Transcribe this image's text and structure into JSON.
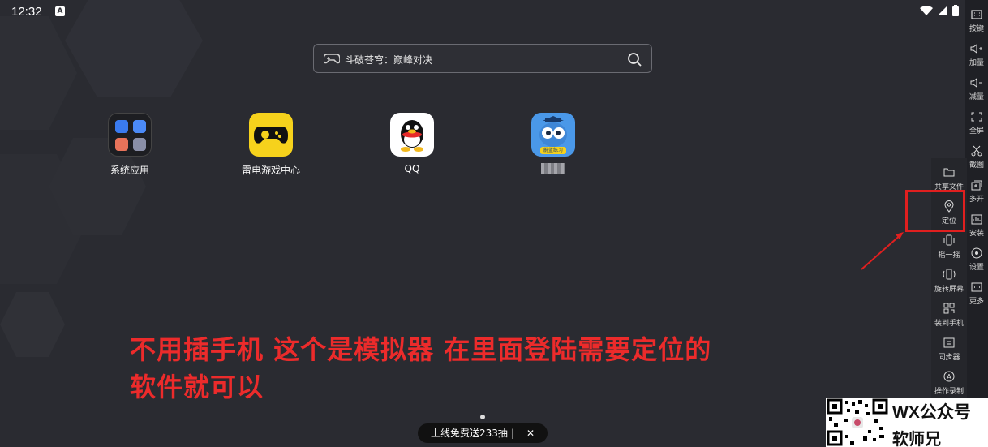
{
  "status_bar": {
    "time": "12:32"
  },
  "search": {
    "text": "斗破苍穹：巅峰对决"
  },
  "apps": [
    {
      "label": "系统应用"
    },
    {
      "label": "雷电游戏中心"
    },
    {
      "label": "QQ"
    },
    {
      "label": "",
      "icon_text": "蔚蓝练习"
    }
  ],
  "right_rail": [
    {
      "label": "按键"
    },
    {
      "label": "加量"
    },
    {
      "label": "减量"
    },
    {
      "label": "全屏"
    },
    {
      "label": "截图"
    },
    {
      "label": "多开"
    },
    {
      "label": "安装"
    },
    {
      "label": "设置"
    },
    {
      "label": "更多"
    }
  ],
  "side_panel": [
    {
      "label": "共享文件"
    },
    {
      "label": "定位"
    },
    {
      "label": "摇一摇"
    },
    {
      "label": "旋转屏幕"
    },
    {
      "label": "装到手机"
    },
    {
      "label": "同步器"
    },
    {
      "label": "操作录制"
    }
  ],
  "caption": {
    "line1": "不用插手机 这个是模拟器 在里面登陆需要定位的",
    "line2": "软件就可以"
  },
  "promo": {
    "text": "上线免费送233抽",
    "close": "✕"
  },
  "watermark": {
    "line1": "WX公众号",
    "line2": "软师兄"
  },
  "colors": {
    "background": "#2a2b31",
    "highlight": "#e01f1f",
    "caption": "#ec2b2b"
  }
}
